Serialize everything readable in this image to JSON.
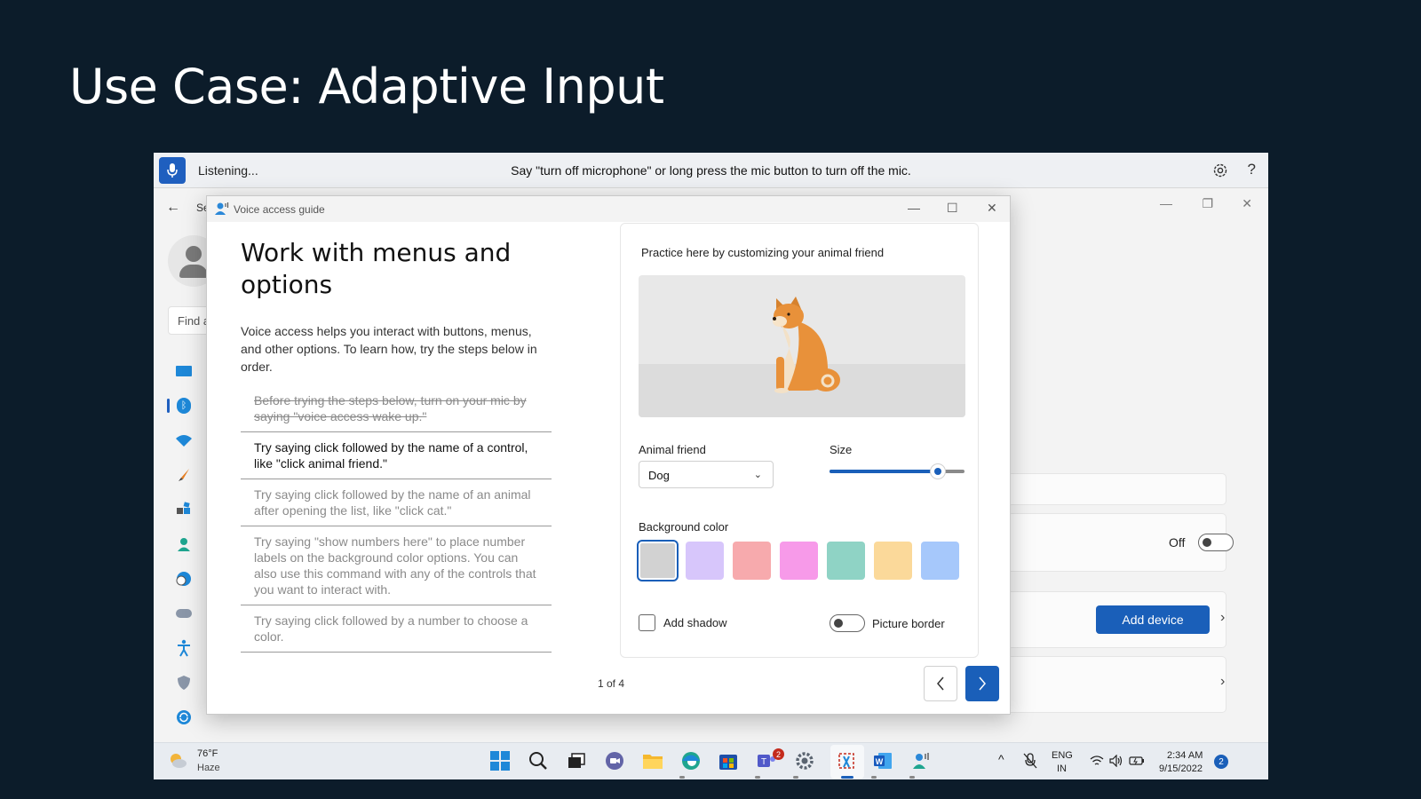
{
  "slide": {
    "title": "Use Case: Adaptive Input"
  },
  "voice_access_bar": {
    "status": "Listening...",
    "message": "Say \"turn off microphone\" or long press the mic button to turn off the mic.",
    "help": "?"
  },
  "settings": {
    "title_partial": "Se",
    "search_placeholder": "Find a",
    "bluetooth_toggle_label": "Off",
    "add_device_label": "Add device"
  },
  "guide": {
    "window_title": "Voice access guide",
    "heading": "Work with menus and options",
    "intro": "Voice access helps you interact with buttons, menus, and other options. To learn how, try the steps below in order.",
    "steps": [
      {
        "text": "Before trying the steps below, turn on your mic by saying \"voice access wake up.\"",
        "state": "done"
      },
      {
        "text": "Try saying click followed by the name of a control, like \"click animal friend.\"",
        "state": "current"
      },
      {
        "text": "Try saying click followed by the name of an animal after opening the list, like \"click cat.\"",
        "state": "pending"
      },
      {
        "text": "Try saying \"show numbers here\" to place number labels on the background color options. You can also use this command with any of the controls that you want to interact with.",
        "state": "pending"
      },
      {
        "text": "Try saying click followed by a number to choose a color.",
        "state": "pending"
      }
    ],
    "page_indicator": "1 of 4",
    "practice": {
      "title": "Practice here by customizing your animal friend",
      "animal_label": "Animal friend",
      "animal_value": "Dog",
      "size_label": "Size",
      "size_value": 0.8,
      "background_label": "Background color",
      "colors": [
        "#d2d2d2",
        "#d7c6fb",
        "#f7aaad",
        "#f79ae9",
        "#8fd3c5",
        "#fbd99a",
        "#a6c8fb"
      ],
      "selected_color_index": 0,
      "shadow_label": "Add shadow",
      "border_label": "Picture border"
    }
  },
  "taskbar": {
    "temperature": "76°F",
    "weather": "Haze",
    "teams_badge": "2",
    "language_line1": "ENG",
    "language_line2": "IN",
    "time": "2:34 AM",
    "date": "9/15/2022",
    "notifications": "2"
  },
  "colors": {
    "accent": "#1a5fb9",
    "slide_bg": "#0c1c2a"
  }
}
